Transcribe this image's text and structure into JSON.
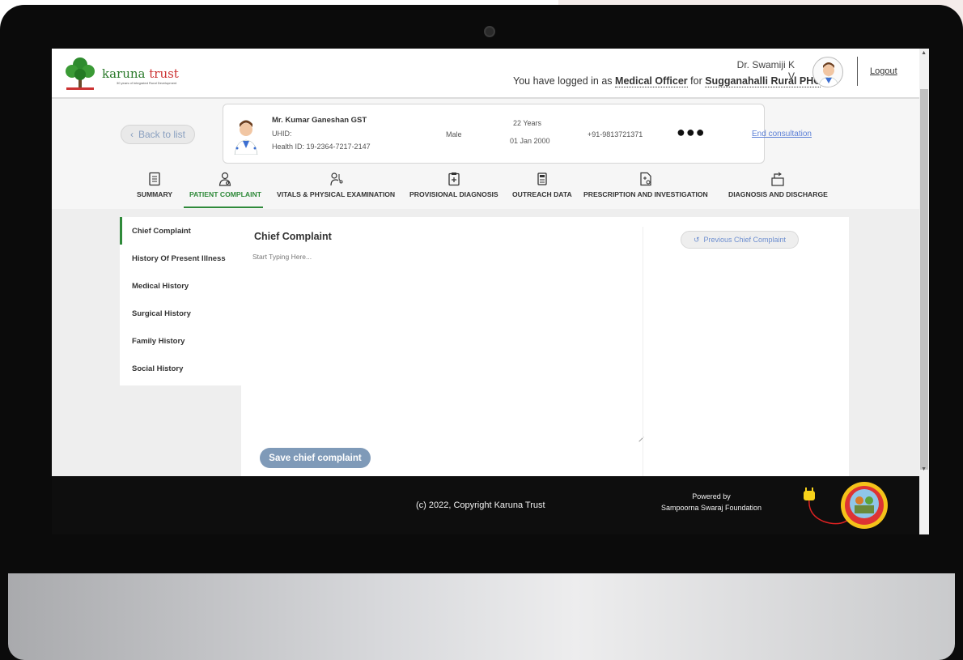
{
  "app": {
    "logo_text_1": "karuna",
    "logo_text_2": "trust",
    "logo_tagline": "30 years of Integrated Rural Development"
  },
  "header": {
    "login_prefix": "You have logged in as ",
    "role": "Medical Officer",
    "for_text": " for ",
    "facility": "Sugganahalli Rural PHC",
    "doctor_name": "Dr. Swamiji K V",
    "logout_label": "Logout"
  },
  "patient": {
    "back_label": "Back to list",
    "name": "Mr. Kumar Ganeshan GST",
    "uhid": "UHID:",
    "health_id": "Health ID: 19-2364-7217-2147",
    "gender": "Male",
    "age": "22 Years",
    "dob": "01 Jan 2000",
    "phone": "+91-9813721371",
    "more_label": "●●●",
    "end_consultation": "End consultation"
  },
  "tabs": [
    {
      "label": "SUMMARY",
      "icon": "document-icon"
    },
    {
      "label": "PATIENT COMPLAINT",
      "icon": "patient-icon",
      "active": true
    },
    {
      "label": "VITALS & PHYSICAL EXAMINATION",
      "icon": "stethoscope-icon"
    },
    {
      "label": "PROVISIONAL DIAGNOSIS",
      "icon": "clipboard-icon"
    },
    {
      "label": "OUTREACH DATA",
      "icon": "outreach-icon"
    },
    {
      "label": "PRESCRIPTION AND INVESTIGATION",
      "icon": "prescription-icon"
    },
    {
      "label": "DIAGNOSIS AND DISCHARGE",
      "icon": "discharge-icon"
    }
  ],
  "side_menu": [
    {
      "label": "Chief Complaint",
      "active": true
    },
    {
      "label": "History Of Present Illness"
    },
    {
      "label": "Medical History"
    },
    {
      "label": "Surgical History"
    },
    {
      "label": "Family History"
    },
    {
      "label": "Social History"
    }
  ],
  "editor": {
    "title": "Chief Complaint",
    "placeholder": "Start Typing Here...",
    "previous_label": "Previous Chief Complaint",
    "save_label": "Save chief complaint"
  },
  "footer": {
    "copyright": "(c) 2022, Copyright Karuna Trust",
    "powered_by": "Powered by",
    "foundation": "Sampoorna Swaraj Foundation",
    "badge_text": "SAMPOORNA SWARAJ"
  },
  "colors": {
    "accent_green": "#2f8a3a",
    "link_blue": "#5b7fd6",
    "save_button": "#7f9ab8",
    "footer_bg": "#0e0e0e"
  }
}
